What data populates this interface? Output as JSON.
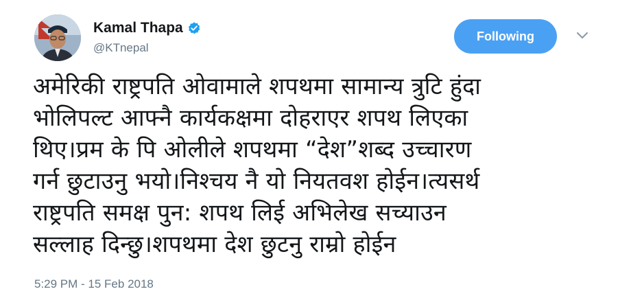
{
  "author": {
    "display_name": "Kamal Thapa",
    "handle": "@KTnepal",
    "verified": true,
    "avatar_icon": "user-avatar-photo"
  },
  "actions": {
    "follow_label": "Following",
    "follow_color": "#4aa1f3",
    "more_icon": "chevron-down-icon"
  },
  "tweet": {
    "text": "अमेरिकी राष्ट्रपति ओवामाले शपथमा सामान्य त्रुटि हुंदा\nभोलिपल्ट आफ्नै कार्यकक्षमा दोहराएर शपथ लिएका\nथिए।प्रम के पि ओलीले शपथमा “देश”शब्द उच्चारण\nगर्न छुटाउनु भयो।निश्चय नै यो नियतवश होईन।त्यसर्थ\nराष्ट्रपति समक्ष पुन: शपथ लिई अभिलेख सच्याउन\nसल्लाह दिन्छु।शपथमा देश छुटनु राम्रो होईन",
    "timestamp": "5:29 PM - 15 Feb 2018"
  },
  "colors": {
    "text_primary": "#14171a",
    "text_secondary": "#657786",
    "verified_badge": "#1da1f2"
  }
}
